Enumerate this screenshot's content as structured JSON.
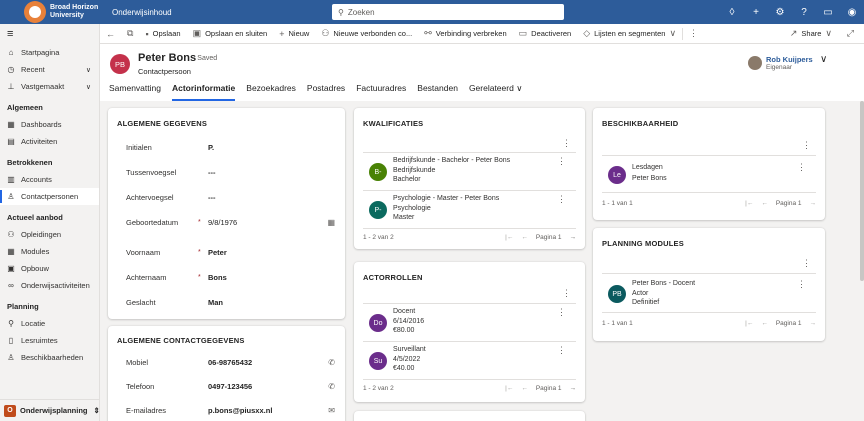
{
  "app": {
    "org_line1": "Broad Horizon",
    "org_line2": "University",
    "app_name": "Onderwijsinhoud",
    "search_placeholder": "Zoeken"
  },
  "sidebar": {
    "pinned": [
      {
        "label": "Startpagina",
        "icon": "home-icon"
      },
      {
        "label": "Recent",
        "icon": "clock-icon"
      },
      {
        "label": "Vastgemaakt",
        "icon": "pin-icon"
      }
    ],
    "groups": [
      {
        "title": "Algemeen",
        "items": [
          {
            "label": "Dashboards",
            "icon": "dashboard-icon"
          },
          {
            "label": "Activiteiten",
            "icon": "activity-icon"
          }
        ]
      },
      {
        "title": "Betrokkenen",
        "items": [
          {
            "label": "Accounts",
            "icon": "building-icon"
          },
          {
            "label": "Contactpersonen",
            "icon": "person-icon"
          }
        ]
      },
      {
        "title": "Actueel aanbod",
        "items": [
          {
            "label": "Opleidingen",
            "icon": "people-icon"
          },
          {
            "label": "Modules",
            "icon": "grid-icon"
          },
          {
            "label": "Opbouw",
            "icon": "box-icon"
          },
          {
            "label": "Onderwijsactiviteiten",
            "icon": "link-icon"
          }
        ]
      },
      {
        "title": "Planning",
        "items": [
          {
            "label": "Locatie",
            "icon": "location-icon"
          },
          {
            "label": "Lesruimtes",
            "icon": "door-icon"
          },
          {
            "label": "Beschikbaarheden",
            "icon": "person-check-icon"
          }
        ]
      }
    ],
    "area": {
      "badge": "O",
      "label": "Onderwijsplanning"
    }
  },
  "commands": {
    "save": "Opslaan",
    "save_close": "Opslaan en sluiten",
    "new": "Nieuw",
    "new_connection": "Nieuwe verbonden co...",
    "disconnect": "Verbinding verbreken",
    "deactivate": "Deactiveren",
    "lists": "Lijsten en segmenten",
    "share": "Share"
  },
  "record": {
    "initials": "PB",
    "name": "Peter Bons",
    "saved": "- Saved",
    "type": "Contactpersoon",
    "owner_name": "Rob Kuijpers",
    "owner_role": "Eigenaar"
  },
  "tabs": [
    "Samenvatting",
    "Actorinformatie",
    "Bezoekadres",
    "Postadres",
    "Factuuradres",
    "Bestanden",
    "Gerelateerd"
  ],
  "general": {
    "title": "ALGEMENE GEGEVENS",
    "fields": [
      {
        "label": "Initialen",
        "value": "P.",
        "req": ""
      },
      {
        "label": "Tussenvoegsel",
        "value": "---",
        "req": ""
      },
      {
        "label": "Achtervoegsel",
        "value": "---",
        "req": ""
      },
      {
        "label": "Geboortedatum",
        "value": "9/8/1976",
        "req": "*"
      },
      {
        "label": "Voornaam",
        "value": "Peter",
        "req": "*"
      },
      {
        "label": "Achternaam",
        "value": "Bons",
        "req": "*"
      },
      {
        "label": "Geslacht",
        "value": "Man",
        "req": ""
      }
    ]
  },
  "contact": {
    "title": "ALGEMENE CONTACTGEGEVENS",
    "fields": [
      {
        "label": "Mobiel",
        "value": "06-98765432"
      },
      {
        "label": "Telefoon",
        "value": "0497-123456"
      },
      {
        "label": "E-mailadres",
        "value": "p.bons@piusxx.nl"
      }
    ]
  },
  "qualifications": {
    "title": "KWALIFICATIES",
    "rows": [
      {
        "initials": "B-",
        "color": "#498205",
        "l1": "Bedrijfskunde - Bachelor - Peter Bons",
        "l2": "Bedrijfskunde",
        "l3": "Bachelor"
      },
      {
        "initials": "P-",
        "color": "#0b6a5f",
        "l1": "Psychologie - Master - Peter Bons",
        "l2": "Psychologie",
        "l3": "Master"
      }
    ],
    "count": "1 - 2 van 2",
    "page": "Pagina 1"
  },
  "roles": {
    "title": "ACTORROLLEN",
    "rows": [
      {
        "initials": "Do",
        "color": "#6b2d8b",
        "l1": "Docent",
        "l2": "6/14/2016",
        "l3": "€80.00"
      },
      {
        "initials": "Su",
        "color": "#6b2d8b",
        "l1": "Surveillant",
        "l2": "4/5/2022",
        "l3": "€40.00"
      }
    ],
    "count": "1 - 2 van 2",
    "page": "Pagina 1"
  },
  "availability": {
    "title": "BESCHIKBAARHEID",
    "rows": [
      {
        "initials": "Le",
        "color": "#6b2d8b",
        "l1": "Lesdagen",
        "l2": "Peter Bons"
      }
    ],
    "count": "1 - 1 van 1",
    "page": "Pagina 1"
  },
  "planning": {
    "title": "PLANNING MODULES",
    "rows": [
      {
        "initials": "PB",
        "color": "#0b5a5f",
        "l1": "Peter Bons - Docent",
        "l2": "Actor",
        "l3": "Definitief"
      }
    ],
    "count": "1 - 1 van 1",
    "page": "Pagina 1"
  }
}
